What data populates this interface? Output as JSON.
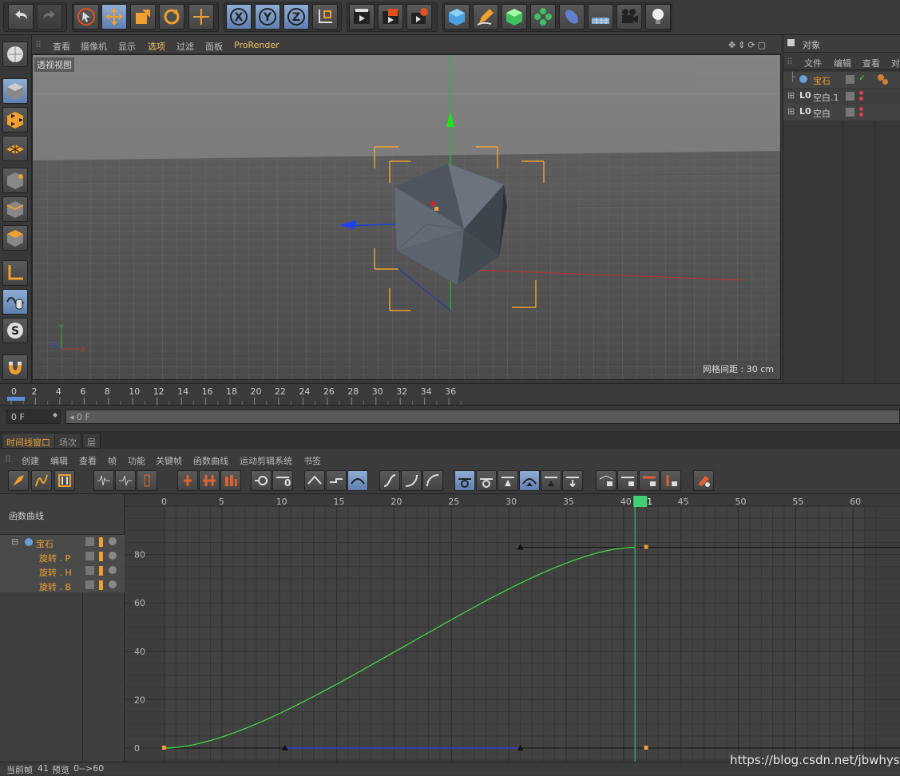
{
  "viewport_menu": [
    "查看",
    "摄像机",
    "显示",
    "选项",
    "过滤",
    "面板",
    "ProRender"
  ],
  "viewport_label": "透视视图",
  "grid_spacing": "网格间距 : 30 cm",
  "objects_panel": {
    "title": "对象",
    "menu": [
      "文件",
      "编辑",
      "查看",
      "对"
    ],
    "items": [
      {
        "name": "宝石",
        "color": "#f0a030"
      },
      {
        "name": "空白.1",
        "color": "#c8c8c8"
      },
      {
        "name": "空白",
        "color": "#c8c8c8"
      }
    ]
  },
  "ruler_labels": [
    "0",
    "2",
    "4",
    "6",
    "8",
    "10",
    "12",
    "14",
    "16",
    "18",
    "20",
    "22",
    "24",
    "26",
    "28",
    "30",
    "32",
    "34",
    "36"
  ],
  "frame_field": "0 F",
  "frame_slider": "0 F",
  "timeline_tabs": [
    "时间线窗口",
    "场次",
    "层"
  ],
  "timeline_menu": [
    "创建",
    "编辑",
    "查看",
    "帧",
    "功能",
    "关键帧",
    "函数曲线",
    "运动剪辑系统",
    "书签"
  ],
  "fcurve_label": "函数曲线",
  "tracks": [
    {
      "name": "宝石",
      "level": 0
    },
    {
      "name": "旋转 . P",
      "level": 1
    },
    {
      "name": "旋转 . H",
      "level": 1
    },
    {
      "name": "旋转 . B",
      "level": 1
    }
  ],
  "graph_x_labels": [
    "0",
    "5",
    "10",
    "15",
    "20",
    "25",
    "30",
    "35",
    "40",
    "41",
    "45",
    "50",
    "55",
    "60"
  ],
  "graph_y_labels": [
    "80",
    "60",
    "40",
    "20",
    "0"
  ],
  "current_frame_marker": "41",
  "status": {
    "current_frame_label": "当前帧",
    "current_frame": "41",
    "preview_label": "预览",
    "preview_range": "0-->60"
  },
  "watermark": "https://blog.csdn.net/jbwhysy",
  "colors": {
    "accent_orange": "#f0a030",
    "curve_green": "#3de040",
    "playhead": "#40d070",
    "highlight_blue": "#7090c0"
  },
  "chart_data": {
    "type": "line",
    "series": [
      {
        "values_x": [
          0,
          5,
          10,
          15,
          20,
          25,
          30,
          35,
          40,
          41
        ],
        "values_y": [
          0,
          4,
          13,
          26,
          40,
          54,
          67,
          76,
          82,
          83
        ]
      }
    ],
    "keys": [
      [
        0,
        0
      ],
      [
        41,
        83
      ]
    ],
    "tangent_handles": [
      [
        10.5,
        0
      ],
      [
        31,
        83
      ]
    ],
    "xlim": [
      0,
      60
    ],
    "ylim": [
      0,
      90
    ]
  }
}
